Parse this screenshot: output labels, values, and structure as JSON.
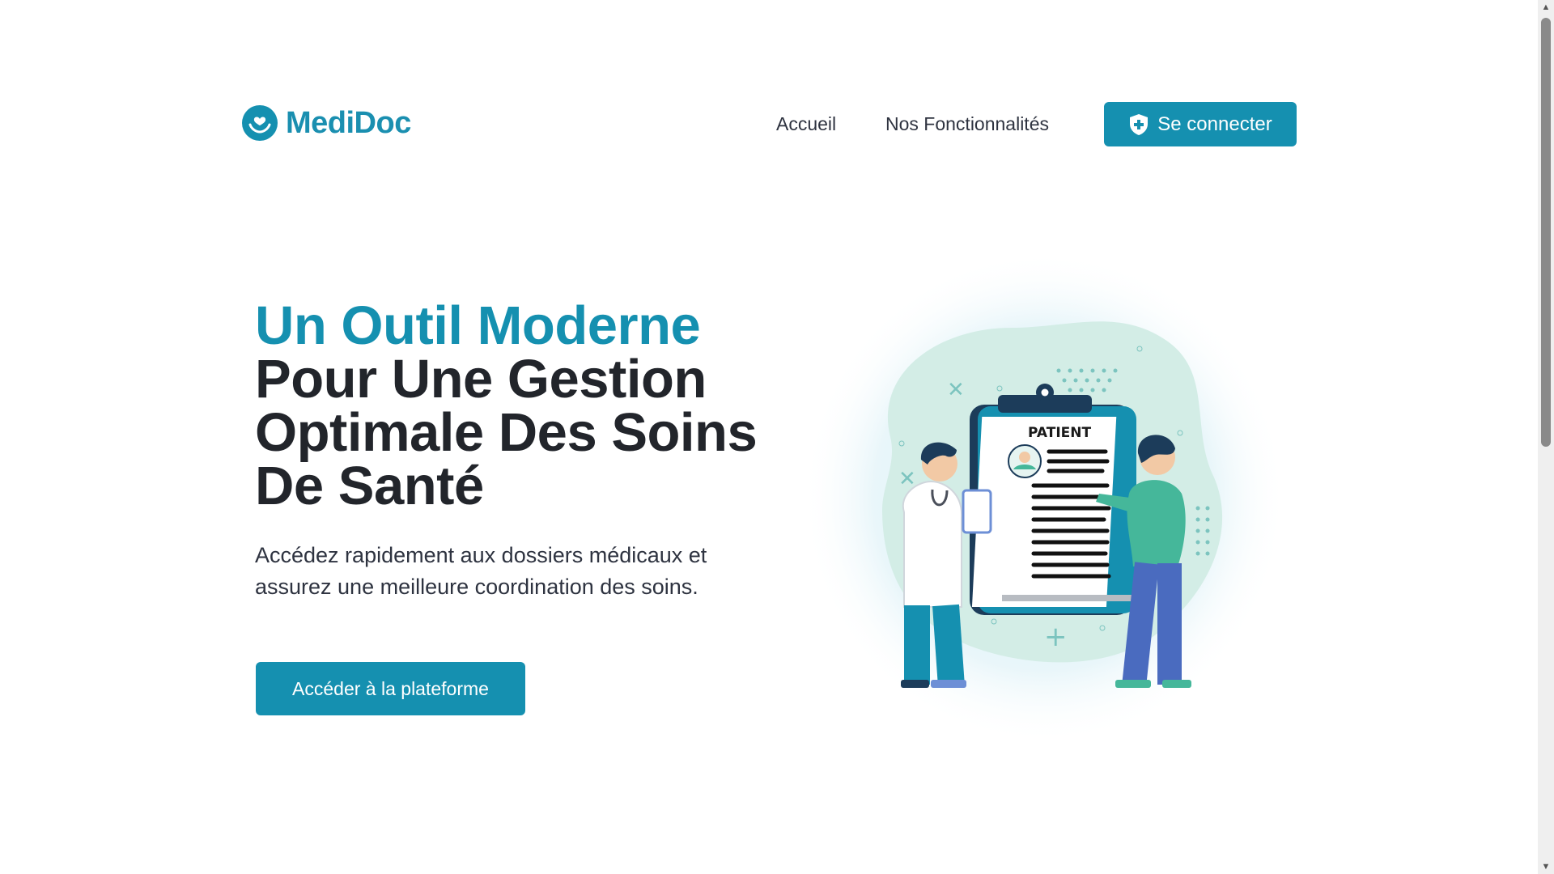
{
  "brand": {
    "name": "MediDoc"
  },
  "nav": {
    "items": [
      {
        "label": "Accueil"
      },
      {
        "label": "Nos Fonctionnalités"
      }
    ],
    "login_label": "Se connecter"
  },
  "hero": {
    "title_accent": "Un Outil Moderne",
    "title_rest": "Pour Une Gestion Optimale Des Soins De Santé",
    "subtitle": "Accédez rapidement aux dossiers médicaux et assurez une meilleure coordination des soins.",
    "cta_label": "Accéder à la plateforme"
  },
  "illustration": {
    "clipboard_label": "PATIENT"
  },
  "colors": {
    "primary": "#1590b0",
    "text": "#22252b",
    "mint": "#d6efe8"
  }
}
